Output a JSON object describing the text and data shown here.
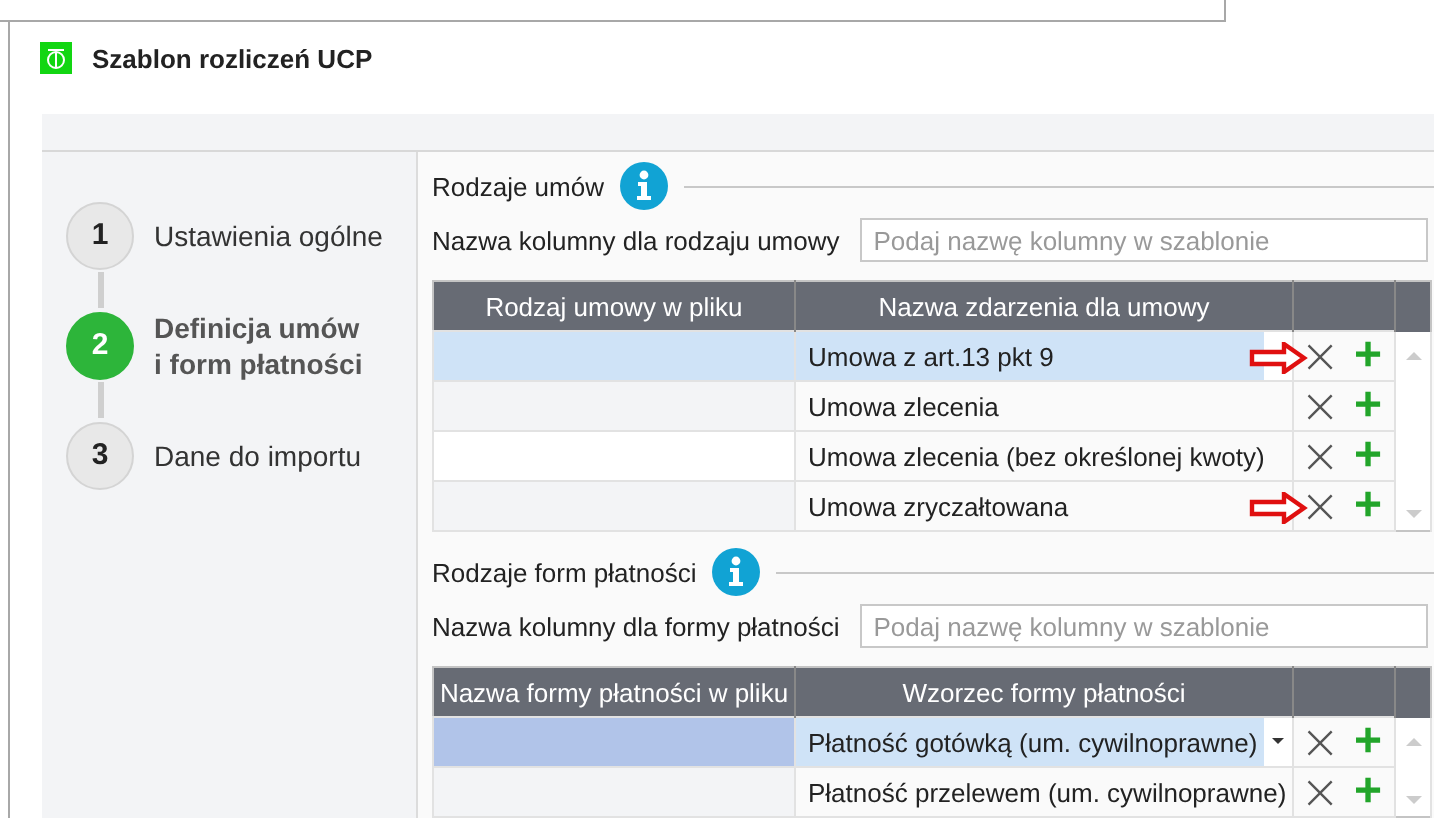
{
  "window": {
    "title": "Szablon rozliczeń UCP"
  },
  "steps": [
    {
      "number": "1",
      "label": "Ustawienia ogólne",
      "selected": false
    },
    {
      "number": "2",
      "label": "Definicja umów\ni form płatności",
      "selected": true
    },
    {
      "number": "3",
      "label": "Dane do importu",
      "selected": false
    }
  ],
  "sections": [
    {
      "title": "Rodzaje umów",
      "field_label": "Nazwa kolumny dla rodzaju umowy",
      "placeholder": "Podaj nazwę kolumny w szablonie",
      "columns": [
        "Rodzaj umowy w pliku",
        "Nazwa zdarzenia dla umowy"
      ],
      "rows": [
        {
          "column_1": "",
          "column_2": "Umowa z art.13 pkt 9",
          "selected": true,
          "dropdown": true,
          "marked": true,
          "delete": "×",
          "add": "+"
        },
        {
          "column_1": "",
          "column_2": "Umowa zlecenia",
          "selected": false,
          "dropdown": false,
          "marked": false,
          "delete": "×",
          "add": "+"
        },
        {
          "column_1": "",
          "column_2": "Umowa zlecenia (bez określonej kwoty)",
          "selected": false,
          "dropdown": false,
          "marked": false,
          "delete": "×",
          "add": "+"
        },
        {
          "column_1": "",
          "column_2": "Umowa zryczałtowana",
          "selected": false,
          "dropdown": false,
          "marked": true,
          "delete": "×",
          "add": "+"
        }
      ]
    },
    {
      "title": "Rodzaje form płatności",
      "field_label": "Nazwa kolumny dla formy płatności",
      "placeholder": "Podaj nazwę kolumny w szablonie",
      "columns": [
        "Nazwa formy płatności w pliku",
        "Wzorzec formy płatności"
      ],
      "rows": [
        {
          "column_1": "",
          "column_2": "Płatność gotówką (um. cywilnoprawne)",
          "selected": true,
          "dropdown": true,
          "marked": false,
          "delete": "×",
          "add": "+"
        },
        {
          "column_1": "",
          "column_2": "Płatność przelewem (um. cywilnoprawne)",
          "selected": false,
          "dropdown": false,
          "marked": false,
          "delete": "×",
          "add": "+"
        }
      ]
    }
  ]
}
